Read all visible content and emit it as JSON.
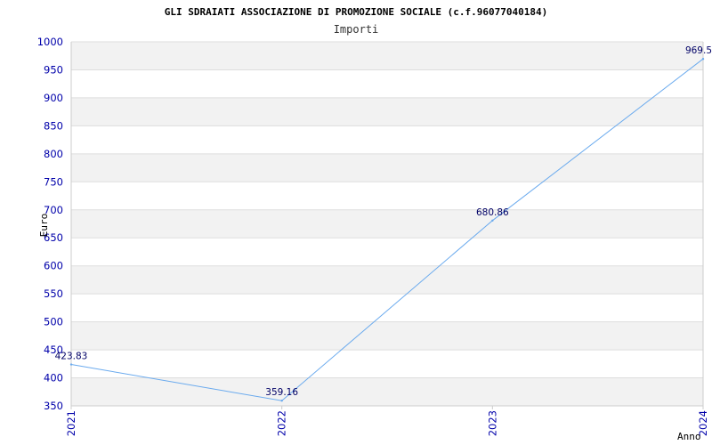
{
  "chart_data": {
    "type": "line",
    "title": "GLI SDRAIATI ASSOCIAZIONE DI PROMOZIONE SOCIALE (c.f.96077040184)",
    "subtitle": "Importi",
    "xlabel": "Anno",
    "ylabel": "Euro",
    "categories": [
      "2021",
      "2022",
      "2023",
      "2024"
    ],
    "series": [
      {
        "values": [
          423.83,
          359.16,
          680.86,
          969.5
        ],
        "labels": [
          "423.83",
          "359.16",
          "680.86",
          "969.5"
        ]
      }
    ],
    "ylim": [
      350,
      1000
    ],
    "yticks": [
      350,
      400,
      450,
      500,
      550,
      600,
      650,
      700,
      750,
      800,
      850,
      900,
      950,
      1000
    ],
    "grid": true,
    "colors": {
      "line": "#6aaaee",
      "band": "#f2f2f2",
      "grid": "#dddddd",
      "tick_text": "#0000aa",
      "data_label": "#000066",
      "axis": "#cccccc"
    }
  }
}
